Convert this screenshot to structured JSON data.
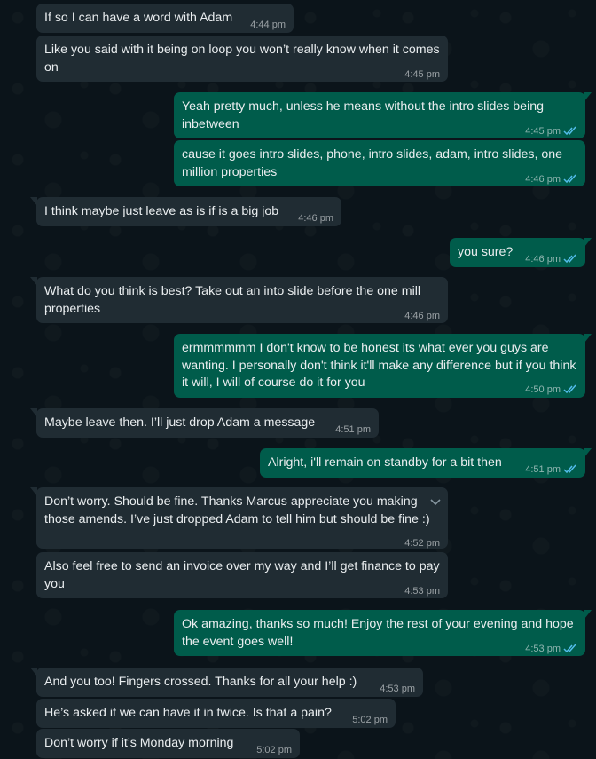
{
  "theme": {
    "background": "#0b141a",
    "incoming_bubble": "#202c33",
    "outgoing_bubble": "#005c4b",
    "read_tick": "#53bdeb"
  },
  "messages": [
    {
      "dir": "in",
      "text": "If so I can have a word with Adam",
      "time": "4:44 pm"
    },
    {
      "dir": "in",
      "text": "Like you said with it being on loop you won’t really know when it comes on",
      "time": "4:45 pm"
    },
    {
      "dir": "out",
      "text": "Yeah pretty much, unless he means without the intro slides being inbetween",
      "time": "4:45 pm",
      "status": "read"
    },
    {
      "dir": "out",
      "text": "cause it goes intro slides, phone, intro slides, adam, intro slides, one million properties",
      "time": "4:46 pm",
      "status": "read"
    },
    {
      "dir": "in",
      "text": "I think maybe just leave as is if is a big job",
      "time": "4:46 pm"
    },
    {
      "dir": "out",
      "text": "you sure?",
      "time": "4:46 pm",
      "status": "read"
    },
    {
      "dir": "in",
      "text": "What do you think is best? Take out an into slide before the one mill properties",
      "time": "4:46 pm"
    },
    {
      "dir": "out",
      "text": "ermmmmmm I don't know to be honest its what ever you guys are wanting. I personally don't think it'll make any difference but if you think it will, I will of course do it for you",
      "time": "4:50 pm",
      "status": "read"
    },
    {
      "dir": "in",
      "text": "Maybe leave then. I’ll just drop Adam a message",
      "time": "4:51 pm"
    },
    {
      "dir": "out",
      "text": "Alright, i'll remain on standby for a bit then",
      "time": "4:51 pm",
      "status": "read"
    },
    {
      "dir": "in",
      "text": "Don’t worry. Should be fine. Thanks Marcus appreciate you making those amends. I’ve just dropped Adam to tell him but should be fine :)",
      "time": "4:52 pm"
    },
    {
      "dir": "in",
      "text": "Also feel free to send an invoice over my way and I’ll get finance to pay you",
      "time": "4:53 pm"
    },
    {
      "dir": "out",
      "text": "Ok amazing, thanks so much! Enjoy the rest of your evening and hope the event goes well!",
      "time": "4:53 pm",
      "status": "read"
    },
    {
      "dir": "in",
      "text": "And you too! Fingers crossed. Thanks for all your help :)",
      "time": "4:53 pm"
    },
    {
      "dir": "in",
      "text": "He’s asked if we can have it in twice. Is that a pain?",
      "time": "5:02 pm"
    },
    {
      "dir": "in",
      "text": "Don’t worry if it’s Monday morning",
      "time": "5:02 pm"
    }
  ]
}
